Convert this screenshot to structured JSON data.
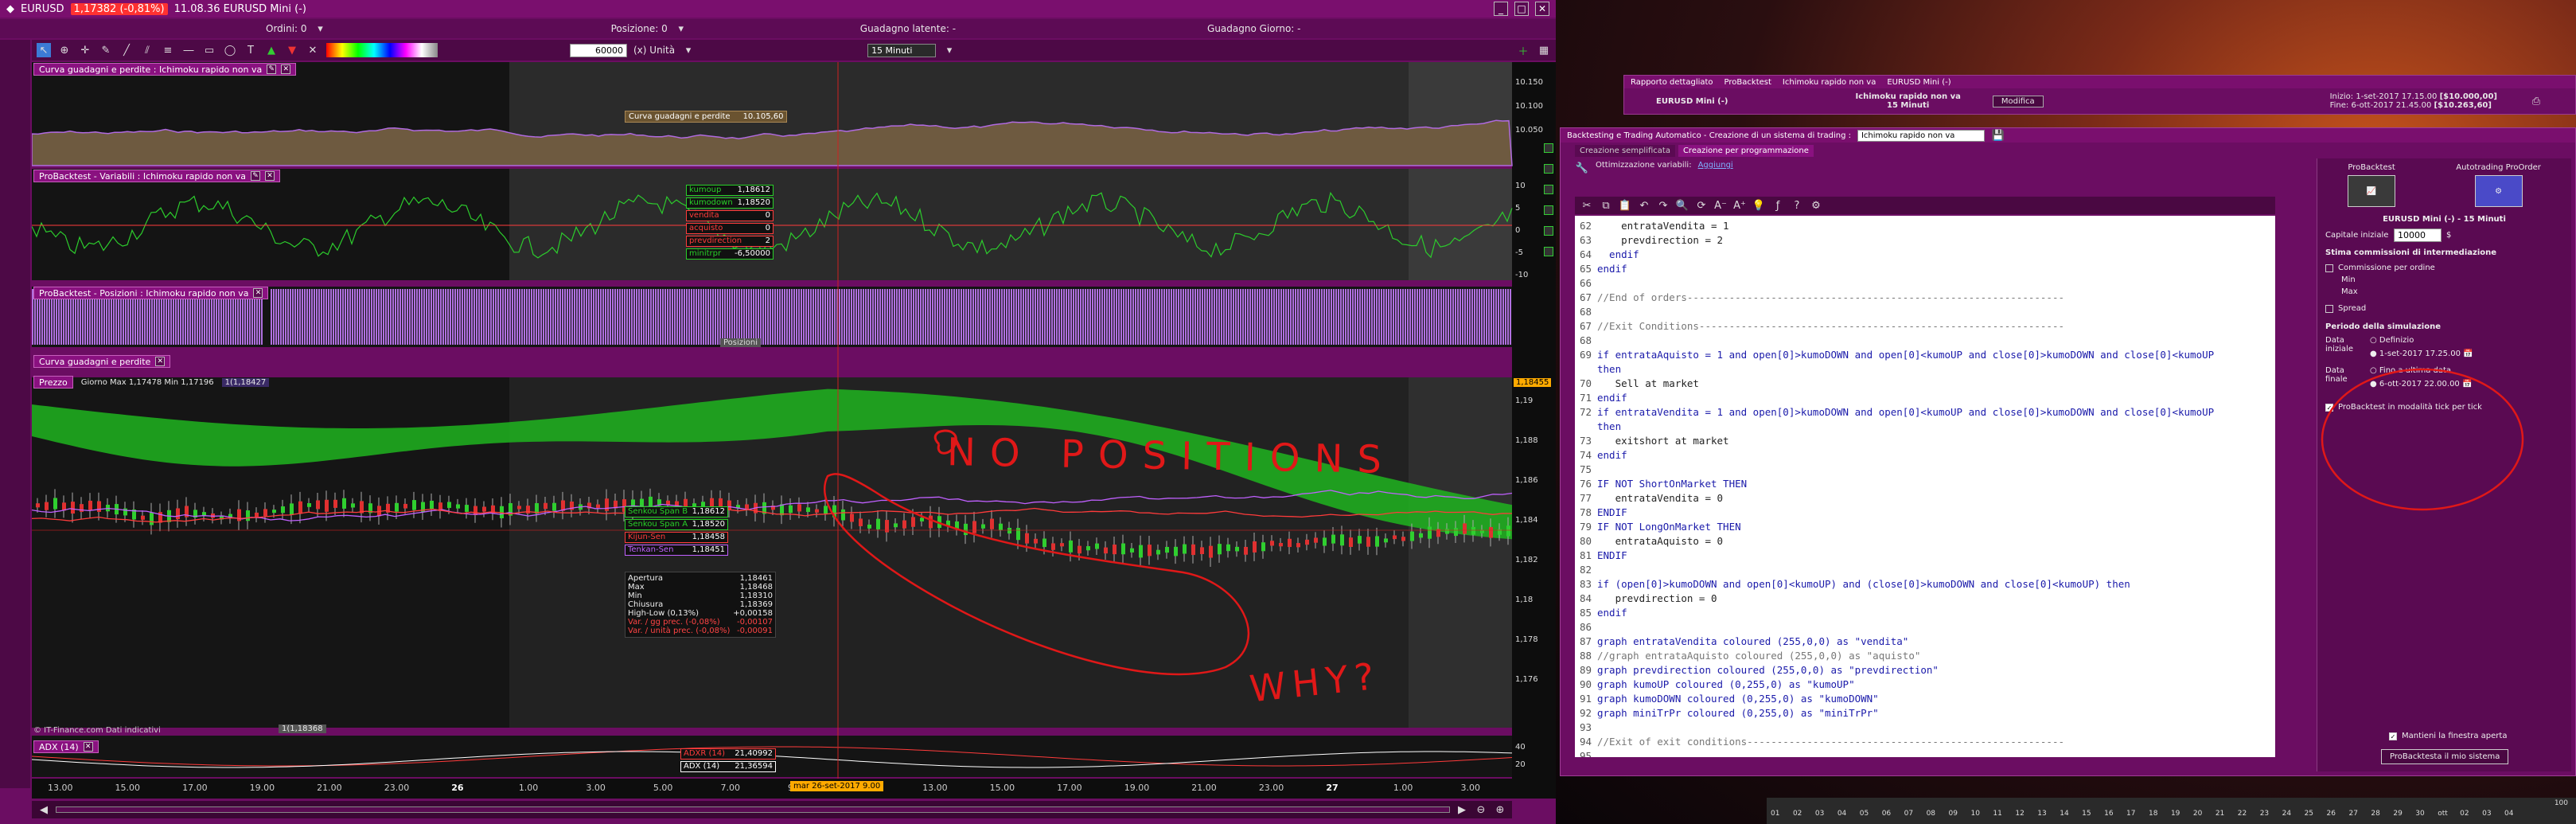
{
  "main": {
    "title": "EURUSD",
    "price_badge": "1,17382 (-0,81%)",
    "title_rest": "11.08.36 EURUSD Mini (-)",
    "orders_label": "Ordini: 0",
    "position_label": "Posizione: 0",
    "latent_label": "Guadagno latente: -",
    "daygain_label": "Guadagno Giorno: -",
    "units_value": "60000",
    "units_label": "(x) Unità",
    "timeframe": "15 Minuti"
  },
  "panels": {
    "equity_title": "Curva guadagni e perdite : Ichimoku rapido non va",
    "equity_label": "Curva guadagni e perdite",
    "equity_value": "10.105,60",
    "variables_title": "ProBacktest - Variabili : Ichimoku rapido non va",
    "positions_title": "ProBacktest - Posizioni : Ichimoku rapido non va",
    "positions_overlay": "Posizioni",
    "equity2_title": "Curva guadagni e perdite",
    "price_title": "Prezzo",
    "price_header": "Giorno Max 1,17478 Min 1,17196",
    "price_header_2": "1(1,18427",
    "adx_title": "ADX (14)",
    "copyright": "© IT-Finance.com Dati indicativi",
    "bottom_marker": "1(1,18368",
    "crosshair_date": "mar 26-set-2017 9.00"
  },
  "variables_legend": [
    {
      "name": "kumoup",
      "value": "1,18612",
      "color": "#28d028"
    },
    {
      "name": "kumodown",
      "value": "1,18520",
      "color": "#28d028"
    },
    {
      "name": "vendita",
      "value": "0",
      "color": "#ff3b3b"
    },
    {
      "name": "acquisto",
      "value": "0",
      "color": "#ff3b3b"
    },
    {
      "name": "prevdirection",
      "value": "2",
      "color": "#ff3b3b"
    },
    {
      "name": "minitrpr",
      "value": "-6,50000",
      "color": "#28d028"
    }
  ],
  "ichimoku_legend": [
    {
      "name": "Senkou Span B",
      "value": "1,18612",
      "color": "#28d028"
    },
    {
      "name": "Senkou Span A",
      "value": "1,18520",
      "color": "#28d028"
    },
    {
      "name": "Kijun-Sen",
      "value": "1,18458",
      "color": "#ff3b3b"
    },
    {
      "name": "Tenkan-Sen",
      "value": "1,18451",
      "color": "#c060ff"
    }
  ],
  "ohlc": [
    {
      "label": "Apertura",
      "value": "1,18461"
    },
    {
      "label": "Max",
      "value": "1,18468"
    },
    {
      "label": "Min",
      "value": "1,18310"
    },
    {
      "label": "Chiusura",
      "value": "1,18369"
    },
    {
      "label": "High-Low (0,13%)",
      "value": "+0,00158"
    },
    {
      "label": "Var. / gg prec. (-0,08%)",
      "value": "-0,00107"
    },
    {
      "label": "Var. / unità prec. (-0,08%)",
      "value": "-0,00091"
    }
  ],
  "adx_legend": [
    {
      "name": "ADXR (14)",
      "value": "21,40992",
      "color": "#ff3b3b"
    },
    {
      "name": "ADX (14)",
      "value": "21,36594",
      "color": "#ffffff"
    }
  ],
  "x_ticks": [
    "13.00",
    "15.00",
    "17.00",
    "19.00",
    "21.00",
    "23.00",
    "26",
    "1.00",
    "3.00",
    "5.00",
    "7.00",
    "9.00",
    "11.00",
    "13.00",
    "15.00",
    "17.00",
    "19.00",
    "21.00",
    "23.00",
    "27",
    "1.00",
    "3.00"
  ],
  "equity_y": [
    "10.150",
    "10.100",
    "10.050"
  ],
  "var_y": [
    "10",
    "5",
    "0",
    "-5",
    "-10"
  ],
  "price_y": [
    "1,19",
    "1,188",
    "1,186",
    "1,184",
    "1,182",
    "1,18",
    "1,178",
    "1,176"
  ],
  "adx_y": [
    "40",
    "20"
  ],
  "price_tag": "1,18455",
  "annotations": {
    "top": "NO POSITIONS",
    "bottom": "WHY?"
  },
  "report": {
    "window_title": "Rapporto dettagliato",
    "tab1": "ProBacktest",
    "tab2": "Ichimoku rapido non va",
    "tab3": "EURUSD Mini (-)",
    "instrument": "EURUSD Mini (-)",
    "strategy": "Ichimoku rapido non va",
    "timeframe": "15 Minuti",
    "modify_btn": "Modifica",
    "start_label": "Inizio:",
    "start_value": "1-set-2017 17.15.00",
    "start_capital": "[$10.000,00]",
    "end_label": "Fine:",
    "end_value": "6-ott-2017 21.45.00",
    "end_capital": "[$10.263,60]"
  },
  "editor": {
    "window_title": "Backtesting e Trading Automatico - Creazione di un sistema di trading :",
    "name_value": "Ichimoku rapido non va",
    "tab_simple": "Creazione semplificata",
    "tab_code": "Creazione per programmazione",
    "opt_label": "Ottimizzazione variabili:",
    "opt_link": "Aggiungi",
    "lines": [
      {
        "n": "62",
        "t": "    entrataVendita = 1"
      },
      {
        "n": "63",
        "t": "    prevdirection = 2"
      },
      {
        "n": "64",
        "t": "  endif"
      },
      {
        "n": "65",
        "t": "endif"
      },
      {
        "n": "66",
        "t": ""
      },
      {
        "n": "67",
        "t": "//End of orders---------------------------------------------------------------"
      },
      {
        "n": "68",
        "t": ""
      },
      {
        "n": "67",
        "t": "//Exit Conditions-------------------------------------------------------------"
      },
      {
        "n": "68",
        "t": ""
      },
      {
        "n": "69",
        "t": "if entrataAquisto = 1 and open[0]>kumoDOWN and open[0]<kumoUP and close[0]>kumoDOWN and close[0]<kumoUP"
      },
      {
        "n": "",
        "t": "then"
      },
      {
        "n": "70",
        "t": "   Sell at market"
      },
      {
        "n": "71",
        "t": "endif"
      },
      {
        "n": "72",
        "t": "if entrataVendita = 1 and open[0]>kumoDOWN and open[0]<kumoUP and close[0]>kumoDOWN and close[0]<kumoUP"
      },
      {
        "n": "",
        "t": "then"
      },
      {
        "n": "73",
        "t": "   exitshort at market"
      },
      {
        "n": "74",
        "t": "endif"
      },
      {
        "n": "75",
        "t": ""
      },
      {
        "n": "76",
        "t": "IF NOT ShortOnMarket THEN"
      },
      {
        "n": "77",
        "t": "   entrataVendita = 0"
      },
      {
        "n": "78",
        "t": "ENDIF"
      },
      {
        "n": "79",
        "t": "IF NOT LongOnMarket THEN"
      },
      {
        "n": "80",
        "t": "   entrataAquisto = 0"
      },
      {
        "n": "81",
        "t": "ENDIF"
      },
      {
        "n": "82",
        "t": ""
      },
      {
        "n": "83",
        "t": "if (open[0]>kumoDOWN and open[0]<kumoUP) and (close[0]>kumoDOWN and close[0]<kumoUP) then"
      },
      {
        "n": "84",
        "t": "   prevdirection = 0"
      },
      {
        "n": "85",
        "t": "endif"
      },
      {
        "n": "86",
        "t": ""
      },
      {
        "n": "87",
        "t": "graph entrataVendita coloured (255,0,0) as \"vendita\""
      },
      {
        "n": "88",
        "t": "//graph entrataAquisto coloured (255,0,0) as \"aquisto\""
      },
      {
        "n": "89",
        "t": "graph prevdirection coloured (255,0,0) as \"prevdirection\""
      },
      {
        "n": "90",
        "t": "graph kumoUP coloured (0,255,0) as \"kumoUP\""
      },
      {
        "n": "91",
        "t": "graph kumoDOWN coloured (0,255,0) as \"kumoDOWN\""
      },
      {
        "n": "92",
        "t": "graph miniTrPr coloured (0,255,0) as \"miniTrPr\""
      },
      {
        "n": "93",
        "t": ""
      },
      {
        "n": "94",
        "t": "//Exit of exit conditions-----------------------------------------------------"
      },
      {
        "n": "95",
        "t": ""
      }
    ]
  },
  "settings": {
    "probacktest": "ProBacktest",
    "autotrading": "Autotrading ProOrder",
    "instrument": "EURUSD Mini (-) - 15 Minuti",
    "capital_label": "Capitale iniziale",
    "capital_value": "10000",
    "currency": "$",
    "commissions_title": "Stima commissioni di intermediazione",
    "commission_order": "Commissione per ordine",
    "min": "Min",
    "max": "Max",
    "spread": "Spread",
    "period_title": "Periodo della simulazione",
    "start_date_label": "Data iniziale",
    "define": "Definizio",
    "start_date": "1-set-2017 17.25.00",
    "end_date_label": "Data finale",
    "until_last": "Fino a ultima data",
    "end_date": "6-ott-2017 22.00.00",
    "tick_mode": "ProBacktest in modalità tick per tick",
    "keep_open": "Mantieni la finestra aperta",
    "run_btn": "ProBacktesta il mio sistema"
  },
  "bottom_scale": [
    "01",
    "02",
    "03",
    "04",
    "05",
    "06",
    "07",
    "08",
    "09",
    "10",
    "11",
    "12",
    "13",
    "14",
    "15",
    "16",
    "17",
    "18",
    "19",
    "20",
    "21",
    "22",
    "23",
    "24",
    "25",
    "26",
    "27",
    "28",
    "29",
    "30",
    "ott",
    "02",
    "03",
    "04"
  ],
  "bottom_scale_end": "100"
}
